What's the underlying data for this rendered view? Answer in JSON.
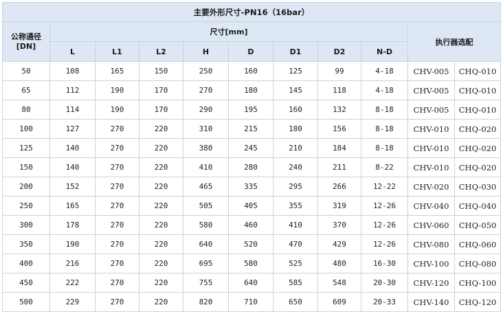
{
  "table": {
    "title": "主要外形尺寸-PN16（16bar）",
    "dn_header_line1": "公称通径",
    "dn_header_line2": "[DN]",
    "dims_header": "尺寸[mm]",
    "actuator_header": "执行器选配",
    "columns": [
      "L",
      "L1",
      "L2",
      "H",
      "D",
      "D1",
      "D2",
      "N-D"
    ],
    "rows": [
      [
        "50",
        "108",
        "165",
        "150",
        "250",
        "160",
        "125",
        "99",
        "4-18",
        "CHV-005",
        "CHQ-010"
      ],
      [
        "65",
        "112",
        "190",
        "170",
        "270",
        "180",
        "145",
        "118",
        "4-18",
        "CHV-005",
        "CHQ-010"
      ],
      [
        "80",
        "114",
        "190",
        "170",
        "290",
        "195",
        "160",
        "132",
        "8-18",
        "CHV-005",
        "CHQ-010"
      ],
      [
        "100",
        "127",
        "270",
        "220",
        "310",
        "215",
        "180",
        "156",
        "8-18",
        "CHV-010",
        "CHQ-020"
      ],
      [
        "125",
        "140",
        "270",
        "220",
        "380",
        "245",
        "210",
        "184",
        "8-18",
        "CHV-010",
        "CHQ-020"
      ],
      [
        "150",
        "140",
        "270",
        "220",
        "410",
        "280",
        "240",
        "211",
        "8-22",
        "CHV-010",
        "CHQ-020"
      ],
      [
        "200",
        "152",
        "270",
        "220",
        "465",
        "335",
        "295",
        "266",
        "12-22",
        "CHV-020",
        "CHQ-030"
      ],
      [
        "250",
        "165",
        "270",
        "220",
        "505",
        "405",
        "355",
        "319",
        "12-26",
        "CHV-040",
        "CHQ-040"
      ],
      [
        "300",
        "178",
        "270",
        "220",
        "580",
        "460",
        "410",
        "370",
        "12-26",
        "CHV-060",
        "CHQ-050"
      ],
      [
        "350",
        "190",
        "270",
        "220",
        "640",
        "520",
        "470",
        "429",
        "12-26",
        "CHV-080",
        "CHQ-060"
      ],
      [
        "400",
        "216",
        "270",
        "220",
        "695",
        "580",
        "525",
        "480",
        "16-30",
        "CHV-100",
        "CHQ-080"
      ],
      [
        "450",
        "222",
        "270",
        "220",
        "755",
        "640",
        "585",
        "548",
        "20-30",
        "CHV-120",
        "CHQ-100"
      ],
      [
        "500",
        "229",
        "270",
        "220",
        "820",
        "710",
        "650",
        "609",
        "20-33",
        "CHV-140",
        "CHQ-120"
      ]
    ]
  },
  "colors": {
    "header_bg": "#dde8f4",
    "border": "#c8d2de",
    "cell_bg": "#ffffff"
  }
}
